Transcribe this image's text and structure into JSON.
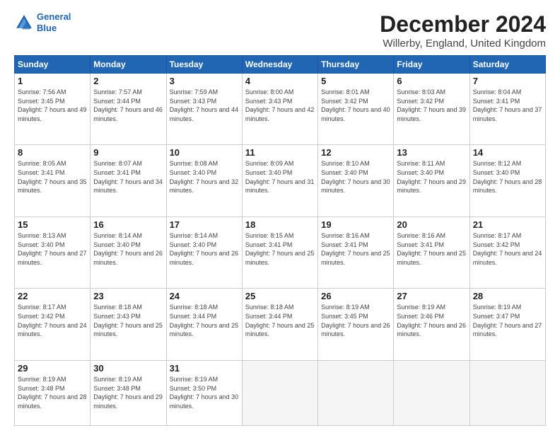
{
  "header": {
    "logo_line1": "General",
    "logo_line2": "Blue",
    "title": "December 2024",
    "subtitle": "Willerby, England, United Kingdom"
  },
  "calendar": {
    "days_of_week": [
      "Sunday",
      "Monday",
      "Tuesday",
      "Wednesday",
      "Thursday",
      "Friday",
      "Saturday"
    ],
    "weeks": [
      [
        {
          "day": null,
          "info": ""
        },
        {
          "day": "2",
          "info": "Sunrise: 7:57 AM\nSunset: 3:44 PM\nDaylight: 7 hours\nand 46 minutes."
        },
        {
          "day": "3",
          "info": "Sunrise: 7:59 AM\nSunset: 3:43 PM\nDaylight: 7 hours\nand 44 minutes."
        },
        {
          "day": "4",
          "info": "Sunrise: 8:00 AM\nSunset: 3:43 PM\nDaylight: 7 hours\nand 42 minutes."
        },
        {
          "day": "5",
          "info": "Sunrise: 8:01 AM\nSunset: 3:42 PM\nDaylight: 7 hours\nand 40 minutes."
        },
        {
          "day": "6",
          "info": "Sunrise: 8:03 AM\nSunset: 3:42 PM\nDaylight: 7 hours\nand 39 minutes."
        },
        {
          "day": "7",
          "info": "Sunrise: 8:04 AM\nSunset: 3:41 PM\nDaylight: 7 hours\nand 37 minutes."
        }
      ],
      [
        {
          "day": "8",
          "info": "Sunrise: 8:05 AM\nSunset: 3:41 PM\nDaylight: 7 hours\nand 35 minutes."
        },
        {
          "day": "9",
          "info": "Sunrise: 8:07 AM\nSunset: 3:41 PM\nDaylight: 7 hours\nand 34 minutes."
        },
        {
          "day": "10",
          "info": "Sunrise: 8:08 AM\nSunset: 3:40 PM\nDaylight: 7 hours\nand 32 minutes."
        },
        {
          "day": "11",
          "info": "Sunrise: 8:09 AM\nSunset: 3:40 PM\nDaylight: 7 hours\nand 31 minutes."
        },
        {
          "day": "12",
          "info": "Sunrise: 8:10 AM\nSunset: 3:40 PM\nDaylight: 7 hours\nand 30 minutes."
        },
        {
          "day": "13",
          "info": "Sunrise: 8:11 AM\nSunset: 3:40 PM\nDaylight: 7 hours\nand 29 minutes."
        },
        {
          "day": "14",
          "info": "Sunrise: 8:12 AM\nSunset: 3:40 PM\nDaylight: 7 hours\nand 28 minutes."
        }
      ],
      [
        {
          "day": "15",
          "info": "Sunrise: 8:13 AM\nSunset: 3:40 PM\nDaylight: 7 hours\nand 27 minutes."
        },
        {
          "day": "16",
          "info": "Sunrise: 8:14 AM\nSunset: 3:40 PM\nDaylight: 7 hours\nand 26 minutes."
        },
        {
          "day": "17",
          "info": "Sunrise: 8:14 AM\nSunset: 3:40 PM\nDaylight: 7 hours\nand 26 minutes."
        },
        {
          "day": "18",
          "info": "Sunrise: 8:15 AM\nSunset: 3:41 PM\nDaylight: 7 hours\nand 25 minutes."
        },
        {
          "day": "19",
          "info": "Sunrise: 8:16 AM\nSunset: 3:41 PM\nDaylight: 7 hours\nand 25 minutes."
        },
        {
          "day": "20",
          "info": "Sunrise: 8:16 AM\nSunset: 3:41 PM\nDaylight: 7 hours\nand 25 minutes."
        },
        {
          "day": "21",
          "info": "Sunrise: 8:17 AM\nSunset: 3:42 PM\nDaylight: 7 hours\nand 24 minutes."
        }
      ],
      [
        {
          "day": "22",
          "info": "Sunrise: 8:17 AM\nSunset: 3:42 PM\nDaylight: 7 hours\nand 24 minutes."
        },
        {
          "day": "23",
          "info": "Sunrise: 8:18 AM\nSunset: 3:43 PM\nDaylight: 7 hours\nand 25 minutes."
        },
        {
          "day": "24",
          "info": "Sunrise: 8:18 AM\nSunset: 3:44 PM\nDaylight: 7 hours\nand 25 minutes."
        },
        {
          "day": "25",
          "info": "Sunrise: 8:18 AM\nSunset: 3:44 PM\nDaylight: 7 hours\nand 25 minutes."
        },
        {
          "day": "26",
          "info": "Sunrise: 8:19 AM\nSunset: 3:45 PM\nDaylight: 7 hours\nand 26 minutes."
        },
        {
          "day": "27",
          "info": "Sunrise: 8:19 AM\nSunset: 3:46 PM\nDaylight: 7 hours\nand 26 minutes."
        },
        {
          "day": "28",
          "info": "Sunrise: 8:19 AM\nSunset: 3:47 PM\nDaylight: 7 hours\nand 27 minutes."
        }
      ],
      [
        {
          "day": "29",
          "info": "Sunrise: 8:19 AM\nSunset: 3:48 PM\nDaylight: 7 hours\nand 28 minutes."
        },
        {
          "day": "30",
          "info": "Sunrise: 8:19 AM\nSunset: 3:48 PM\nDaylight: 7 hours\nand 29 minutes."
        },
        {
          "day": "31",
          "info": "Sunrise: 8:19 AM\nSunset: 3:50 PM\nDaylight: 7 hours\nand 30 minutes."
        },
        {
          "day": null,
          "info": ""
        },
        {
          "day": null,
          "info": ""
        },
        {
          "day": null,
          "info": ""
        },
        {
          "day": null,
          "info": ""
        }
      ]
    ],
    "week1_day1": {
      "day": "1",
      "info": "Sunrise: 7:56 AM\nSunset: 3:45 PM\nDaylight: 7 hours\nand 49 minutes."
    }
  }
}
